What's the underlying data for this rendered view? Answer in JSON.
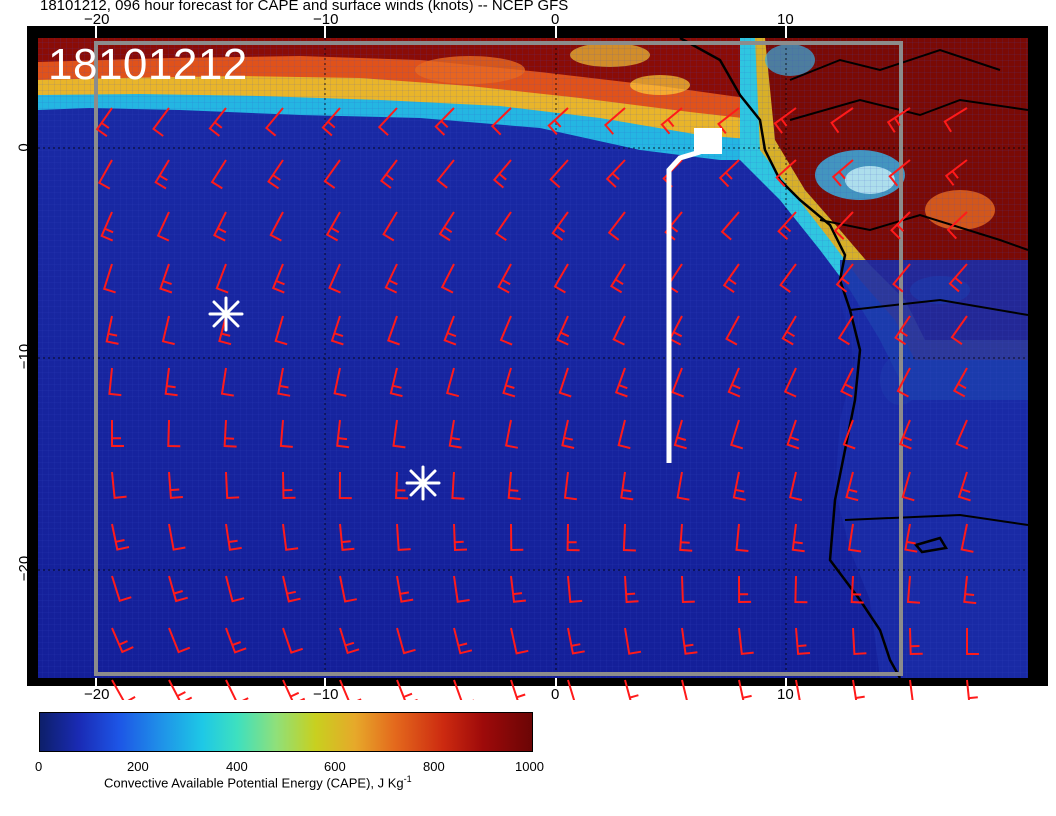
{
  "title": "18101212, 096 hour forecast for CAPE and surface winds (knots) -- NCEP GFS",
  "stamp": "18101212",
  "axes": {
    "x_ticks": [
      "−20",
      "−10",
      "0",
      "10"
    ],
    "y_ticks": [
      "0",
      "−10",
      "−20"
    ]
  },
  "colorbar": {
    "ticks": [
      "0",
      "200",
      "400",
      "600",
      "800",
      "1000"
    ],
    "label": "Convective Available Potential Energy (CAPE), J Kg",
    "label_sup": "-1",
    "range": [
      0,
      1000
    ]
  },
  "markers": {
    "storm_symbols": [
      {
        "name": "asterisk-1",
        "lon": -14.5,
        "lat": -7.8
      },
      {
        "name": "asterisk-2",
        "lon": -5.8,
        "lat": -15.8
      }
    ],
    "track": {
      "lon": [
        5,
        5,
        5.5,
        6.5
      ],
      "lat": [
        -15,
        -1,
        0,
        0.4
      ]
    }
  },
  "colors": {
    "barb": "#ff1a1a",
    "ocean": "#1a2aa8",
    "high_cape": "#7a0a05"
  }
}
